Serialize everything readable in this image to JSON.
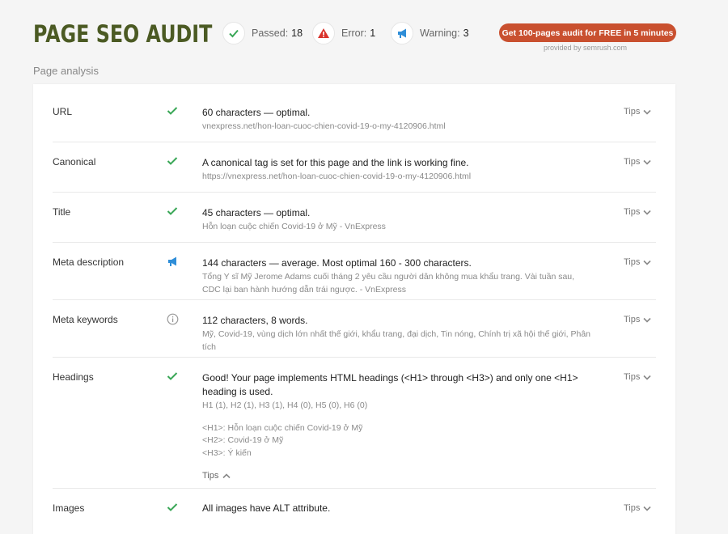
{
  "header": {
    "title": "PAGE SEO AUDIT",
    "stats": {
      "passed": {
        "label": "Passed:",
        "count": "18",
        "icon": "check-icon"
      },
      "error": {
        "label": "Error:",
        "count": "1",
        "icon": "warning-triangle-icon"
      },
      "warning": {
        "label": "Warning:",
        "count": "3",
        "icon": "megaphone-icon"
      }
    },
    "cta_label": "Get 100-pages audit for FREE in 5 minutes",
    "provided_by": "provided by  semrush.com"
  },
  "section_label": "Page analysis",
  "tips_label": "Tips",
  "colors": {
    "title": "#4b5a23",
    "check": "#3aa757",
    "error": "#d9322b",
    "warning": "#2f8ed8",
    "cta": "#c9502f"
  },
  "rows": [
    {
      "name": "URL",
      "status": "check-icon",
      "main": "60 characters — optimal.",
      "sub": "vnexpress.net/hon-loan-cuoc-chien-covid-19-o-my-4120906.html"
    },
    {
      "name": "Canonical",
      "status": "check-icon",
      "main": "A canonical tag is set for this page and the link is working fine.",
      "sub": "https://vnexpress.net/hon-loan-cuoc-chien-covid-19-o-my-4120906.html"
    },
    {
      "name": "Title",
      "status": "check-icon",
      "main": "45 characters — optimal.",
      "sub": "Hỗn loạn cuộc chiến Covid-19 ở Mỹ - VnExpress"
    },
    {
      "name": "Meta description",
      "status": "megaphone-icon",
      "main": "144 characters — average. Most optimal 160 - 300 characters.",
      "sub_lines": [
        "Tổng Y sĩ Mỹ Jerome Adams cuối tháng 2 yêu cầu người dân không mua khẩu trang. Vài tuần sau,",
        "CDC lại ban hành hướng dẫn trái ngược.  - VnExpress"
      ]
    },
    {
      "name": "Meta keywords",
      "status": "info-icon",
      "main": "112 characters, 8 words.",
      "sub_lines": [
        "Mỹ, Covid-19, vùng dịch lớn nhất thế giới, khẩu trang, đại dịch, Tin nóng, Chính trị xã hội thế giới, Phân",
        "tích"
      ]
    },
    {
      "name": "Headings",
      "status": "check-icon",
      "main_lines": [
        "Good! Your page implements HTML headings (<H1> through <H3>) and only one <H1>",
        "heading is used."
      ],
      "sub": "H1 (1), H2 (1), H3 (1), H4 (0), H5 (0), H6 (0)",
      "headings": [
        "<H1>: Hỗn loạn cuộc chiến Covid-19 ở Mỹ",
        "<H2>: Covid-19 ở Mỹ",
        "<H3>: Ý kiến"
      ]
    },
    {
      "name": "Images",
      "status": "check-icon",
      "main": "All images have ALT attribute."
    }
  ]
}
